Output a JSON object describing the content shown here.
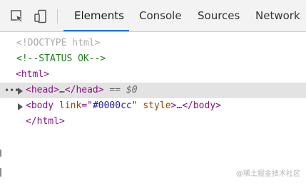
{
  "toolbar": {
    "tabs": [
      {
        "label": "Elements",
        "active": true
      },
      {
        "label": "Console",
        "active": false
      },
      {
        "label": "Sources",
        "active": false
      },
      {
        "label": "Network",
        "active": false
      }
    ],
    "icons": [
      "select-element-icon",
      "device-toggle-icon"
    ]
  },
  "dom": {
    "doctype": "<!DOCTYPE html>",
    "comment": "<!--STATUS OK-->",
    "html_open": "<html>",
    "head": {
      "dots": "•••",
      "open": "<head>",
      "ellipsis": "…",
      "close": "</head>",
      "ref": " == $0"
    },
    "body": {
      "open_start": "<body ",
      "attr1_name": "link",
      "attr1_eq": "=\"",
      "attr1_value": "#0000cc",
      "attr1_end": "\" ",
      "attr2_name": "style",
      "rest_open": ">",
      "ellipsis": "…",
      "close": "</body>"
    },
    "html_close": "</html>"
  },
  "watermark": "@稀土掘金技术社区",
  "colors": {
    "tag": "#881280",
    "attr_name": "#994500",
    "attr_value": "#1a1aa6",
    "comment": "#1e7f1e",
    "accent": "#1a73e8"
  }
}
